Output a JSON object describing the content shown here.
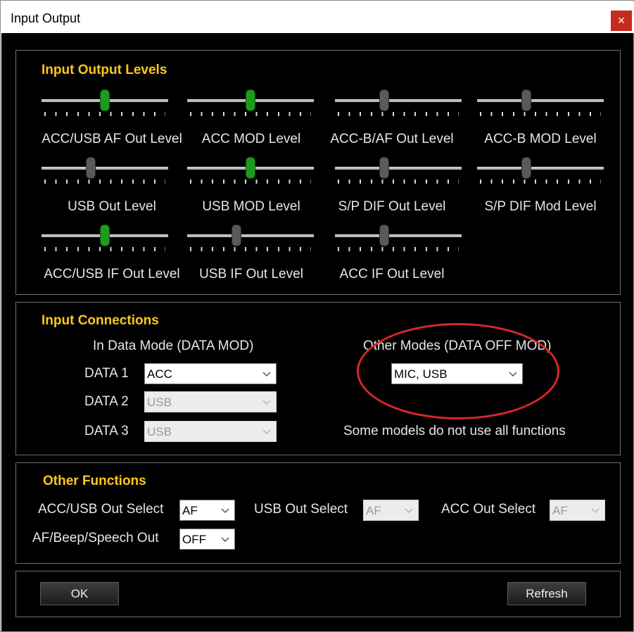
{
  "window": {
    "title": "Input Output",
    "close_glyph": "×"
  },
  "levels": {
    "title": "Input Output Levels",
    "sliders": [
      {
        "label": "ACC/USB AF Out Level",
        "value": 0.5,
        "active": true
      },
      {
        "label": "ACC MOD Level",
        "value": 0.5,
        "active": true
      },
      {
        "label": "ACC-B/AF Out Level",
        "value": 0.38,
        "active": false
      },
      {
        "label": "ACC-B MOD Level",
        "value": 0.38,
        "active": false
      },
      {
        "label": "USB Out Level",
        "value": 0.38,
        "active": false
      },
      {
        "label": "USB MOD Level",
        "value": 0.5,
        "active": true
      },
      {
        "label": "S/P DIF Out Level",
        "value": 0.38,
        "active": false
      },
      {
        "label": "S/P DIF Mod Level",
        "value": 0.38,
        "active": false
      },
      {
        "label": "ACC/USB IF Out Level",
        "value": 0.5,
        "active": true
      },
      {
        "label": "USB IF Out Level",
        "value": 0.38,
        "active": false
      },
      {
        "label": "ACC IF Out Level",
        "value": 0.38,
        "active": false
      }
    ]
  },
  "connections": {
    "title": "Input Connections",
    "data_mode_heading": "In Data Mode (DATA MOD)",
    "other_modes_heading": "Other Modes (DATA OFF MOD)",
    "data1": {
      "label": "DATA 1",
      "value": "ACC"
    },
    "data2": {
      "label": "DATA 2",
      "value": "USB"
    },
    "data3": {
      "label": "DATA 3",
      "value": "USB"
    },
    "other_mode": {
      "value": "MIC, USB"
    },
    "note": "Some models do not use all functions"
  },
  "functions": {
    "title": "Other Functions",
    "acc_usb_out_select": {
      "label": "ACC/USB Out Select",
      "value": "AF"
    },
    "usb_out_select": {
      "label": "USB Out Select",
      "value": "AF"
    },
    "acc_out_select": {
      "label": "ACC Out Select",
      "value": "AF"
    },
    "af_beep_speech_out": {
      "label": "AF/Beep/Speech Out",
      "value": "OFF"
    }
  },
  "buttons": {
    "ok": "OK",
    "refresh": "Refresh"
  },
  "colors": {
    "accent_title": "#ffc719",
    "thumb_active": "#1f9a1f",
    "annotation": "#d9262b",
    "close": "#c42b1c"
  }
}
